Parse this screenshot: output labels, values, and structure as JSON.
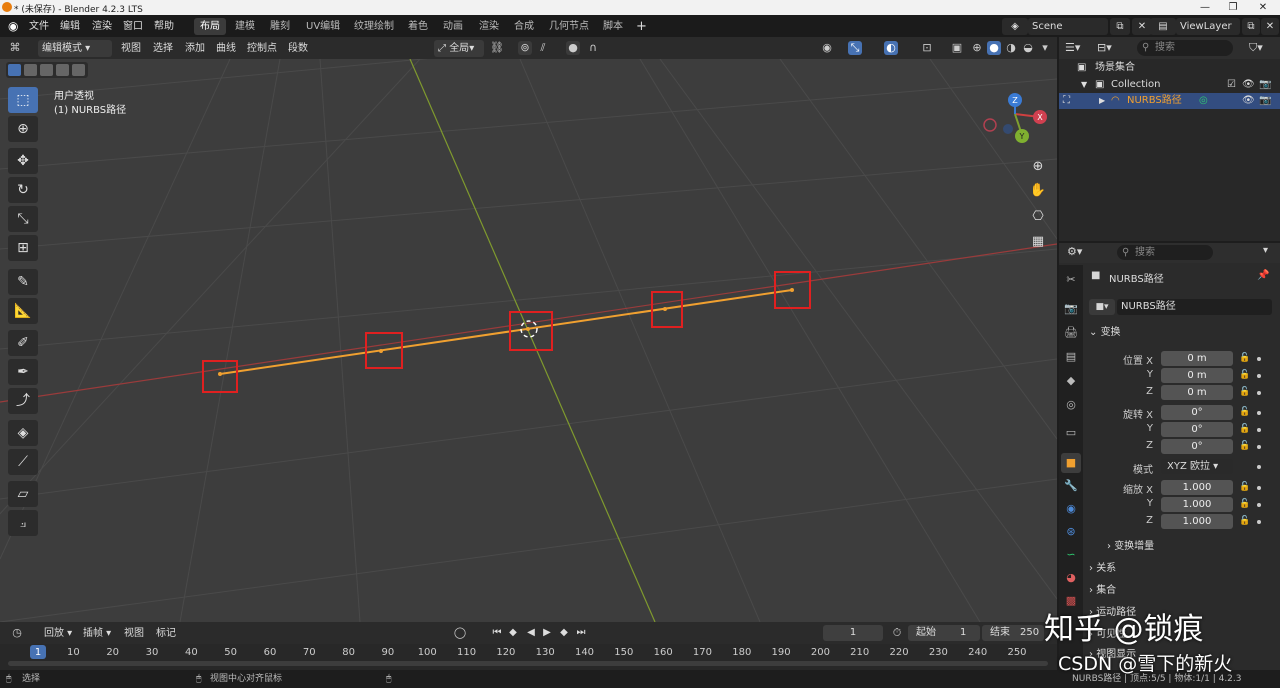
{
  "titlebar": {
    "title": "* (未保存) - Blender 4.2.3 LTS",
    "minimize": "—",
    "maximize": "❐",
    "close": "✕"
  },
  "menu": {
    "file": "文件",
    "edit": "编辑",
    "render": "渲染",
    "window": "窗口",
    "help": "帮助"
  },
  "workspaces": [
    "布局",
    "建模",
    "雕刻",
    "UV编辑",
    "纹理绘制",
    "着色",
    "动画",
    "渲染",
    "合成",
    "几何节点",
    "脚本"
  ],
  "scene": {
    "name": "Scene",
    "view_layer": "ViewLayer"
  },
  "viewport_header": {
    "mode": "编辑模式",
    "view": "视图",
    "select": "选择",
    "add": "添加",
    "curve": "曲线",
    "control_point": "控制点",
    "segment": "段数",
    "orientation": "全局"
  },
  "viewport": {
    "view_name": "用户透视",
    "object_name": "(1) NURBS路径"
  },
  "gizmo": {
    "x": "X",
    "y": "Y",
    "z": "Z"
  },
  "outliner": {
    "search_placeholder": "搜索",
    "scene_collection": "场景集合",
    "collection": "Collection",
    "object": "NURBS路径"
  },
  "properties": {
    "search_placeholder": "搜索",
    "object_name": "NURBS路径",
    "data_name": "NURBS路径",
    "transform_header": "变换",
    "location_label": "位置 X",
    "y_label": "Y",
    "z_label": "Z",
    "location": [
      "0 m",
      "0 m",
      "0 m"
    ],
    "rotation_label": "旋转 X",
    "rotation": [
      "0°",
      "0°",
      "0°"
    ],
    "mode_label": "模式",
    "mode_value": "XYZ 欧拉",
    "scale_label": "缩放 X",
    "scale": [
      "1.000",
      "1.000",
      "1.000"
    ],
    "delta_transform": "变换增量",
    "relations": "关系",
    "collections": "集合",
    "motion_paths": "运动路径",
    "visibility": "可见性",
    "viewport_display": "视图显示"
  },
  "timeline": {
    "playback": "回放",
    "keying": "插帧",
    "view": "视图",
    "marker": "标记",
    "current_frame": "1",
    "start_label": "起始",
    "start": "1",
    "end_label": "结束",
    "end": "250",
    "ticks": [
      "1",
      "10",
      "20",
      "30",
      "40",
      "50",
      "60",
      "70",
      "80",
      "90",
      "100",
      "110",
      "120",
      "130",
      "140",
      "150",
      "160",
      "170",
      "180",
      "190",
      "200",
      "210",
      "220",
      "230",
      "240",
      "250"
    ]
  },
  "statusbar": {
    "select": "选择",
    "center_view": "视图中心对齐鼠标",
    "stats": "NURBS路径 | 顶点:5/5 | 物体:1/1 | 4.2.3"
  },
  "watermarks": {
    "zhihu": "知乎 @锁痕",
    "csdn": "CSDN @雪下的新火"
  },
  "colors": {
    "accent": "#4772b3",
    "curve": "#f0a030",
    "highlight_box": "#e02020",
    "x_axis": "#b04040",
    "y_axis": "#8aa030"
  }
}
